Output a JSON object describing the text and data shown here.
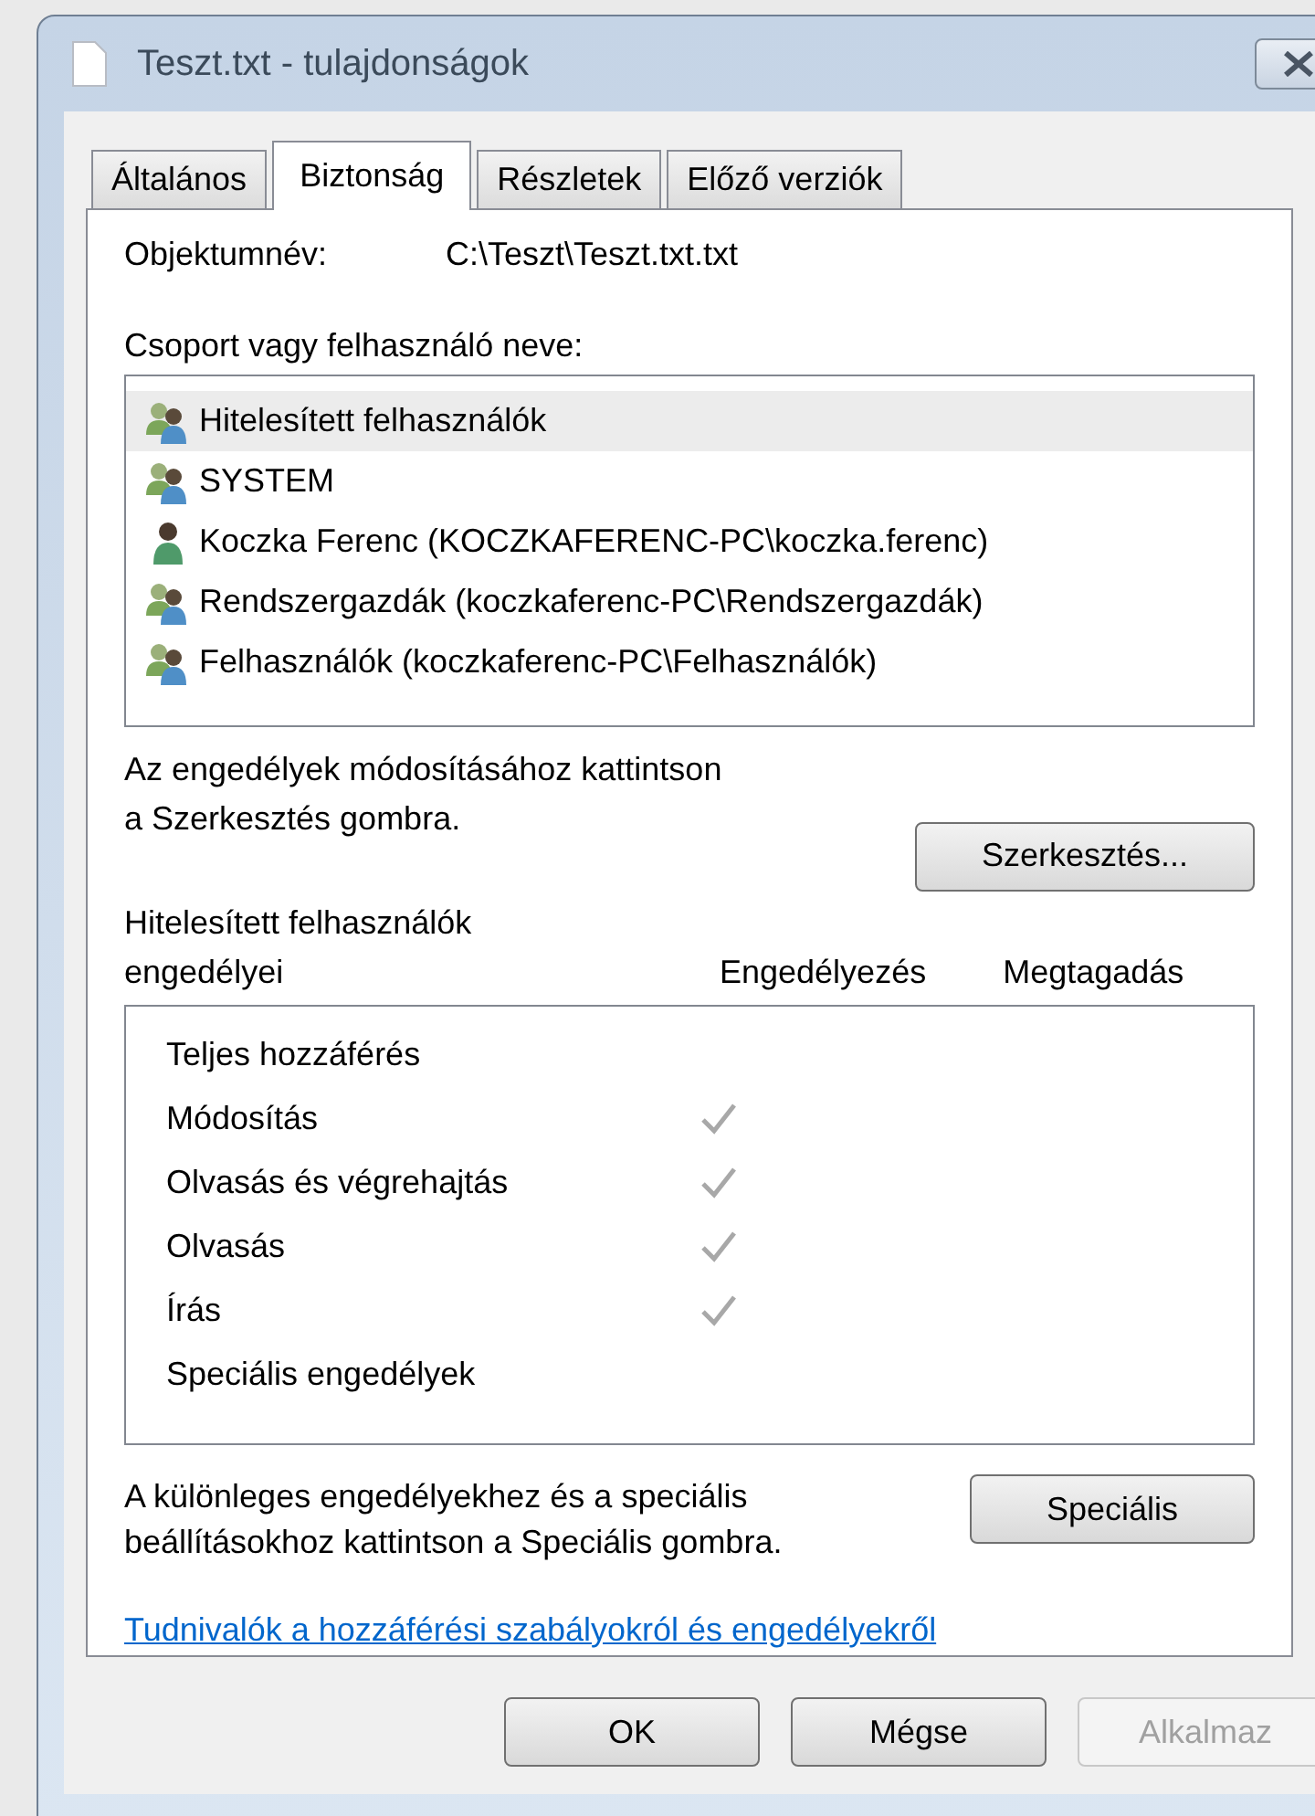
{
  "window": {
    "title": "Teszt.txt - tulajdonságok"
  },
  "tabs": [
    {
      "label": "Általános",
      "selected": false
    },
    {
      "label": "Biztonság",
      "selected": true
    },
    {
      "label": "Részletek",
      "selected": false
    },
    {
      "label": "Előző verziók",
      "selected": false
    }
  ],
  "object_name": {
    "label": "Objektumnév:",
    "value": "C:\\Teszt\\Teszt.txt.txt"
  },
  "group_list": {
    "label": "Csoport vagy felhasználó neve:",
    "items": [
      {
        "name": "Hitelesített felhasználók",
        "kind": "group",
        "selected": true
      },
      {
        "name": "SYSTEM",
        "kind": "group",
        "selected": false
      },
      {
        "name": "Koczka Ferenc (KOCZKAFERENC-PC\\koczka.ferenc)",
        "kind": "user",
        "selected": false
      },
      {
        "name": "Rendszergazdák (koczkaferenc-PC\\Rendszergazdák)",
        "kind": "group",
        "selected": false
      },
      {
        "name": "Felhasználók (koczkaferenc-PC\\Felhasználók)",
        "kind": "group",
        "selected": false
      }
    ]
  },
  "edit_hint": {
    "lines": [
      "Az engedélyek módosításához kattintson",
      "a Szerkesztés gombra."
    ],
    "button": "Szerkesztés..."
  },
  "permissions": {
    "title_lines": [
      "Hitelesített felhasználók",
      "engedélyei"
    ],
    "allow_header": "Engedélyezés",
    "deny_header": "Megtagadás",
    "rows": [
      {
        "name": "Teljes hozzáférés",
        "allow": false,
        "deny": false
      },
      {
        "name": "Módosítás",
        "allow": true,
        "deny": false
      },
      {
        "name": "Olvasás és végrehajtás",
        "allow": true,
        "deny": false
      },
      {
        "name": "Olvasás",
        "allow": true,
        "deny": false
      },
      {
        "name": "Írás",
        "allow": true,
        "deny": false
      },
      {
        "name": "Speciális engedélyek",
        "allow": false,
        "deny": false
      }
    ]
  },
  "special_hint": {
    "lines": [
      "A különleges engedélyekhez és a speciális",
      "beállításokhoz kattintson a Speciális gombra."
    ],
    "button": "Speciális"
  },
  "link": "Tudnivalók a hozzáférési szabályokról és engedélyekről",
  "buttons": [
    {
      "label": "OK",
      "disabled": false
    },
    {
      "label": "Mégse",
      "disabled": false
    },
    {
      "label": "Alkalmaz",
      "disabled": true
    }
  ]
}
